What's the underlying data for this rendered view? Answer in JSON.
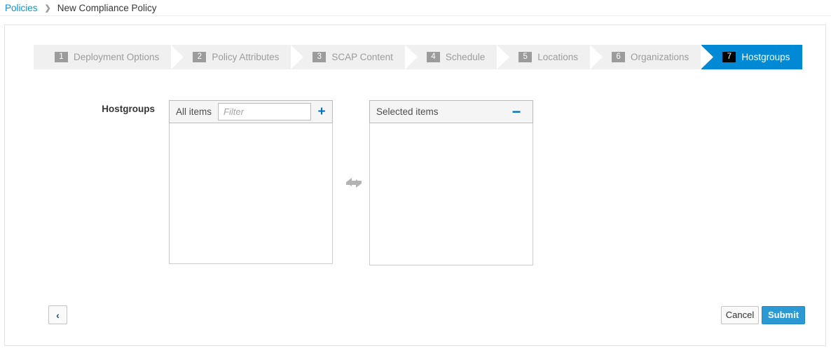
{
  "breadcrumb": {
    "parent": "Policies",
    "separator": "❯",
    "current": "New Compliance Policy"
  },
  "wizard": {
    "steps": [
      {
        "number": "1",
        "label": "Deployment Options",
        "active": false
      },
      {
        "number": "2",
        "label": "Policy Attributes",
        "active": false
      },
      {
        "number": "3",
        "label": "SCAP Content",
        "active": false
      },
      {
        "number": "4",
        "label": "Schedule",
        "active": false
      },
      {
        "number": "5",
        "label": "Locations",
        "active": false
      },
      {
        "number": "6",
        "label": "Organizations",
        "active": false
      },
      {
        "number": "7",
        "label": "Hostgroups",
        "active": true
      }
    ],
    "active_color": "#0089d4",
    "inactive_color": "#f0f0f0"
  },
  "form": {
    "field_label": "Hostgroups",
    "all_items": {
      "title": "All items",
      "filter_value": "",
      "filter_placeholder": "Filter",
      "add_icon": "+",
      "items": []
    },
    "selected_items": {
      "title": "Selected items",
      "remove_icon": "−",
      "items": []
    },
    "swap_icon": "exchange-arrows"
  },
  "footer": {
    "back_icon": "‹",
    "cancel_label": "Cancel",
    "submit_label": "Submit",
    "submit_color": "#2b9ad4"
  }
}
